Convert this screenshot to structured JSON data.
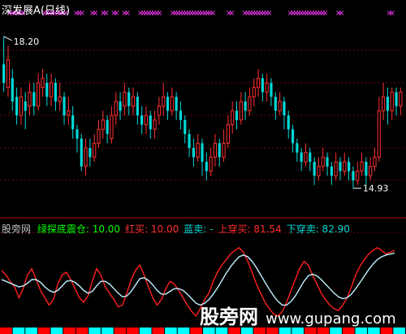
{
  "chart_data": [
    {
      "type": "candlestick",
      "title": "深发展A(日线)",
      "colors": {
        "up": "#ff3030",
        "down": "#00d8d8",
        "title": "#ffffff",
        "marker": "#ff3cff",
        "grid": "#7a0000"
      },
      "ylim": [
        14.4,
        18.6
      ],
      "high_label": "18.20",
      "low_label": "14.93",
      "top_marker_glyph": "×",
      "top_markers_x_index": [
        3,
        4,
        5,
        6,
        7,
        8,
        16,
        17,
        18,
        19,
        20,
        21,
        22,
        23,
        24,
        28,
        29,
        30,
        34,
        35,
        38,
        39,
        42,
        43,
        46,
        47,
        52,
        53,
        54,
        55,
        56,
        57,
        58,
        59,
        64,
        65,
        66,
        67,
        68,
        69,
        70,
        71,
        72,
        73,
        74,
        75,
        76,
        77,
        78,
        79,
        85,
        86,
        91,
        92,
        93,
        94,
        95,
        96,
        97,
        98,
        99,
        100,
        108,
        109,
        110,
        111,
        112,
        113,
        114,
        115,
        116,
        117,
        118,
        119,
        120,
        121,
        126,
        127,
        145,
        146
      ],
      "candles": [
        {
          "o": 17.6,
          "c": 17.2,
          "h": 18.2,
          "l": 17.0
        },
        {
          "o": 17.1,
          "c": 17.7,
          "h": 18.0,
          "l": 16.9
        },
        {
          "o": 17.3,
          "c": 16.8,
          "h": 17.5,
          "l": 16.6
        },
        {
          "o": 16.9,
          "c": 16.5,
          "h": 17.1,
          "l": 16.3
        },
        {
          "o": 16.5,
          "c": 16.9,
          "h": 17.1,
          "l": 16.3
        },
        {
          "o": 16.8,
          "c": 16.6,
          "h": 17.0,
          "l": 16.2
        },
        {
          "o": 16.7,
          "c": 17.0,
          "h": 17.2,
          "l": 16.5
        },
        {
          "o": 17.0,
          "c": 16.7,
          "h": 17.2,
          "l": 16.5
        },
        {
          "o": 16.7,
          "c": 17.2,
          "h": 17.4,
          "l": 16.6
        },
        {
          "o": 17.1,
          "c": 17.3,
          "h": 17.5,
          "l": 16.9
        },
        {
          "o": 17.2,
          "c": 16.9,
          "h": 17.4,
          "l": 16.7
        },
        {
          "o": 16.9,
          "c": 17.2,
          "h": 17.4,
          "l": 16.7
        },
        {
          "o": 17.2,
          "c": 16.8,
          "h": 17.3,
          "l": 16.6
        },
        {
          "o": 16.8,
          "c": 16.9,
          "h": 17.2,
          "l": 16.6
        },
        {
          "o": 16.9,
          "c": 16.5,
          "h": 17.0,
          "l": 16.3
        },
        {
          "o": 16.5,
          "c": 16.6,
          "h": 16.9,
          "l": 16.3
        },
        {
          "o": 16.5,
          "c": 16.2,
          "h": 16.7,
          "l": 16.0
        },
        {
          "o": 16.2,
          "c": 16.0,
          "h": 16.3,
          "l": 15.7
        },
        {
          "o": 16.0,
          "c": 15.4,
          "h": 16.1,
          "l": 15.3
        },
        {
          "o": 15.4,
          "c": 15.8,
          "h": 16.0,
          "l": 15.2
        },
        {
          "o": 15.8,
          "c": 15.6,
          "h": 16.0,
          "l": 15.4
        },
        {
          "o": 15.6,
          "c": 15.9,
          "h": 16.1,
          "l": 15.5
        },
        {
          "o": 15.9,
          "c": 16.2,
          "h": 16.4,
          "l": 15.8
        },
        {
          "o": 16.2,
          "c": 16.4,
          "h": 16.6,
          "l": 16.0
        },
        {
          "o": 16.4,
          "c": 16.1,
          "h": 16.5,
          "l": 15.9
        },
        {
          "o": 16.0,
          "c": 16.5,
          "h": 16.7,
          "l": 15.9
        },
        {
          "o": 16.5,
          "c": 16.8,
          "h": 17.0,
          "l": 16.3
        },
        {
          "o": 16.8,
          "c": 16.6,
          "h": 17.0,
          "l": 16.4
        },
        {
          "o": 16.7,
          "c": 17.0,
          "h": 17.2,
          "l": 16.5
        },
        {
          "o": 17.0,
          "c": 16.7,
          "h": 17.1,
          "l": 16.5
        },
        {
          "o": 16.7,
          "c": 16.9,
          "h": 17.1,
          "l": 16.5
        },
        {
          "o": 16.9,
          "c": 16.5,
          "h": 17.0,
          "l": 16.3
        },
        {
          "o": 16.5,
          "c": 16.3,
          "h": 16.7,
          "l": 16.1
        },
        {
          "o": 16.3,
          "c": 16.5,
          "h": 16.7,
          "l": 16.1
        },
        {
          "o": 16.5,
          "c": 16.2,
          "h": 16.6,
          "l": 16.0
        },
        {
          "o": 16.2,
          "c": 16.4,
          "h": 16.6,
          "l": 16.0
        },
        {
          "o": 16.5,
          "c": 16.7,
          "h": 16.9,
          "l": 16.3
        },
        {
          "o": 16.7,
          "c": 16.9,
          "h": 17.2,
          "l": 16.5
        },
        {
          "o": 16.9,
          "c": 16.6,
          "h": 17.0,
          "l": 16.4
        },
        {
          "o": 16.6,
          "c": 16.9,
          "h": 17.1,
          "l": 16.5
        },
        {
          "o": 16.9,
          "c": 16.6,
          "h": 17.0,
          "l": 16.4
        },
        {
          "o": 16.6,
          "c": 16.4,
          "h": 16.8,
          "l": 16.2
        },
        {
          "o": 16.4,
          "c": 16.1,
          "h": 16.5,
          "l": 15.9
        },
        {
          "o": 16.1,
          "c": 15.8,
          "h": 16.2,
          "l": 15.6
        },
        {
          "o": 15.8,
          "c": 15.6,
          "h": 16.0,
          "l": 15.4
        },
        {
          "o": 15.6,
          "c": 15.9,
          "h": 16.1,
          "l": 15.5
        },
        {
          "o": 15.9,
          "c": 15.5,
          "h": 16.0,
          "l": 15.2
        },
        {
          "o": 15.5,
          "c": 15.3,
          "h": 15.7,
          "l": 15.1
        },
        {
          "o": 15.3,
          "c": 15.6,
          "h": 15.8,
          "l": 15.2
        },
        {
          "o": 15.6,
          "c": 15.9,
          "h": 16.1,
          "l": 15.4
        },
        {
          "o": 15.9,
          "c": 15.6,
          "h": 16.0,
          "l": 15.4
        },
        {
          "o": 15.6,
          "c": 15.9,
          "h": 16.2,
          "l": 15.5
        },
        {
          "o": 15.9,
          "c": 16.3,
          "h": 16.5,
          "l": 15.8
        },
        {
          "o": 16.3,
          "c": 16.6,
          "h": 16.8,
          "l": 16.1
        },
        {
          "o": 16.6,
          "c": 16.4,
          "h": 16.8,
          "l": 16.2
        },
        {
          "o": 16.4,
          "c": 16.8,
          "h": 17.0,
          "l": 16.3
        },
        {
          "o": 16.8,
          "c": 16.6,
          "h": 17.0,
          "l": 16.4
        },
        {
          "o": 16.6,
          "c": 16.9,
          "h": 17.1,
          "l": 16.5
        },
        {
          "o": 16.9,
          "c": 17.1,
          "h": 17.3,
          "l": 16.7
        },
        {
          "o": 17.1,
          "c": 17.3,
          "h": 17.5,
          "l": 16.9
        },
        {
          "o": 17.3,
          "c": 17.0,
          "h": 17.4,
          "l": 16.8
        },
        {
          "o": 17.0,
          "c": 17.2,
          "h": 17.4,
          "l": 16.8
        },
        {
          "o": 17.2,
          "c": 16.9,
          "h": 17.3,
          "l": 16.7
        },
        {
          "o": 16.9,
          "c": 16.6,
          "h": 17.0,
          "l": 16.4
        },
        {
          "o": 16.6,
          "c": 16.8,
          "h": 17.0,
          "l": 16.5
        },
        {
          "o": 16.8,
          "c": 16.5,
          "h": 16.9,
          "l": 16.2
        },
        {
          "o": 16.5,
          "c": 16.2,
          "h": 16.6,
          "l": 16.0
        },
        {
          "o": 16.2,
          "c": 15.9,
          "h": 16.3,
          "l": 15.7
        },
        {
          "o": 15.9,
          "c": 15.7,
          "h": 16.0,
          "l": 15.5
        },
        {
          "o": 15.7,
          "c": 15.5,
          "h": 15.8,
          "l": 15.3
        },
        {
          "o": 15.5,
          "c": 15.7,
          "h": 15.9,
          "l": 15.4
        },
        {
          "o": 15.7,
          "c": 15.5,
          "h": 15.8,
          "l": 15.3
        },
        {
          "o": 15.5,
          "c": 15.2,
          "h": 15.6,
          "l": 15.0
        },
        {
          "o": 15.2,
          "c": 15.4,
          "h": 15.6,
          "l": 15.1
        },
        {
          "o": 15.4,
          "c": 15.6,
          "h": 15.8,
          "l": 15.3
        },
        {
          "o": 15.6,
          "c": 15.4,
          "h": 15.7,
          "l": 15.2
        },
        {
          "o": 15.4,
          "c": 15.2,
          "h": 15.5,
          "l": 15.0
        },
        {
          "o": 15.2,
          "c": 15.5,
          "h": 15.7,
          "l": 15.1
        },
        {
          "o": 15.5,
          "c": 15.3,
          "h": 15.6,
          "l": 15.1
        },
        {
          "o": 15.3,
          "c": 15.5,
          "h": 15.7,
          "l": 15.2
        },
        {
          "o": 15.5,
          "c": 15.3,
          "h": 15.6,
          "l": 15.1
        },
        {
          "o": 15.3,
          "c": 15.1,
          "h": 15.4,
          "l": 14.93
        },
        {
          "o": 15.1,
          "c": 15.3,
          "h": 15.5,
          "l": 15.0
        },
        {
          "o": 15.3,
          "c": 15.5,
          "h": 15.7,
          "l": 15.2
        },
        {
          "o": 15.5,
          "c": 15.2,
          "h": 15.6,
          "l": 15.0
        },
        {
          "o": 15.2,
          "c": 15.4,
          "h": 15.6,
          "l": 15.1
        },
        {
          "o": 15.4,
          "c": 15.6,
          "h": 15.8,
          "l": 15.3
        },
        {
          "o": 15.6,
          "c": 16.6,
          "h": 16.9,
          "l": 15.5
        },
        {
          "o": 16.6,
          "c": 16.9,
          "h": 17.2,
          "l": 16.4
        },
        {
          "o": 16.9,
          "c": 16.6,
          "h": 17.1,
          "l": 16.3
        },
        {
          "o": 16.6,
          "c": 17.0,
          "h": 17.1,
          "l": 16.4
        },
        {
          "o": 17.0,
          "c": 16.7,
          "h": 17.1,
          "l": 16.5
        },
        {
          "o": 16.7,
          "c": 17.0,
          "h": 17.1,
          "l": 16.5
        }
      ]
    },
    {
      "type": "line",
      "title": "绿探底震仓",
      "legend": [
        {
          "label": "绿探底震仓:",
          "value": "10.00",
          "color": "#00ff00"
        },
        {
          "label": "红买:",
          "value": "10.00",
          "color": "#ff3030"
        },
        {
          "label": "蓝卖:",
          "value": "-",
          "color": "#00d8d8"
        },
        {
          "label": "上穿买:",
          "value": "81.54",
          "color": "#ff3030"
        },
        {
          "label": "下穿卖:",
          "value": "82.90",
          "color": "#00d8d8"
        }
      ],
      "ylim": [
        0,
        100
      ],
      "series": [
        {
          "name": "红买",
          "color": "#ff2020",
          "values": [
            60,
            55,
            48,
            42,
            30,
            40,
            55,
            62,
            50,
            38,
            30,
            22,
            28,
            45,
            55,
            58,
            50,
            40,
            30,
            25,
            32,
            48,
            62,
            55,
            42,
            35,
            28,
            20,
            22,
            35,
            50,
            60,
            66,
            55,
            42,
            30,
            22,
            28,
            40,
            48,
            45,
            38,
            30,
            22,
            15,
            10,
            18,
            28,
            35,
            48,
            58,
            66,
            72,
            78,
            82,
            85,
            80,
            70,
            58,
            45,
            35,
            25,
            18,
            12,
            10,
            15,
            25,
            38,
            50,
            62,
            70,
            66,
            55,
            45,
            35,
            28,
            22,
            18,
            16,
            22,
            30,
            42,
            55,
            65,
            72,
            78,
            82,
            85,
            82,
            78,
            80,
            82
          ]
        },
        {
          "name": "蓝卖",
          "color": "#c0f0ff",
          "values": [
            50,
            48,
            46,
            44,
            42,
            43,
            46,
            50,
            50,
            47,
            42,
            38,
            36,
            38,
            43,
            48,
            49,
            47,
            43,
            38,
            35,
            37,
            43,
            48,
            48,
            45,
            40,
            35,
            31,
            32,
            37,
            44,
            51,
            52,
            49,
            44,
            38,
            34,
            34,
            37,
            40,
            40,
            38,
            34,
            29,
            24,
            22,
            24,
            28,
            34,
            41,
            49,
            57,
            64,
            70,
            75,
            77,
            75,
            70,
            63,
            55,
            47,
            39,
            32,
            26,
            22,
            22,
            26,
            32,
            40,
            48,
            54,
            56,
            54,
            50,
            45,
            40,
            35,
            31,
            29,
            30,
            34,
            40,
            47,
            54,
            61,
            67,
            72,
            75,
            77,
            78,
            79
          ]
        }
      ],
      "bottom_strip_colors": [
        "#00ffff",
        "#ff0000"
      ]
    }
  ],
  "watermark": {
    "brand": "股旁网",
    "url": "www.gupang.com"
  },
  "corner_label": "股旁网"
}
